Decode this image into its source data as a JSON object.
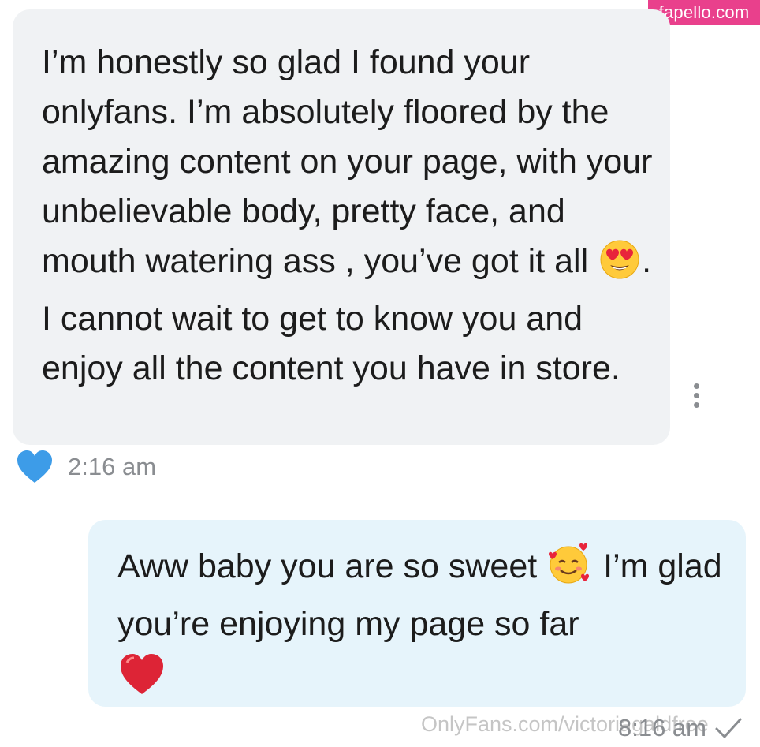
{
  "watermarks": {
    "top": "fapello.com",
    "bottom": "OnlyFans.com/victoriagaldfree"
  },
  "messages": [
    {
      "direction": "incoming",
      "text_part1": "I’m honestly so glad I found your onlyfans. I’m absolutely floored by the amazing content on your page, with your unbelievable body, pretty face, and mouth watering ass , you’ve got it all",
      "emoji1": "heart-eyes-emoji",
      "text_part2": ". I cannot wait to get to know you and enjoy all the content you have in store.",
      "time": "2:16 am",
      "liked": true
    },
    {
      "direction": "outgoing",
      "text_part1": "Aww baby you are so sweet",
      "emoji1": "smiling-face-with-hearts-emoji",
      "text_part2": "I’m glad you’re enjoying my page so far",
      "emoji2": "red-heart-emoji",
      "time": "8:16 am",
      "read": true
    }
  ],
  "colors": {
    "incoming_bubble": "#f0f2f4",
    "outgoing_bubble": "#e6f4fb",
    "like_heart": "#3d9ce8",
    "meta_text": "#8a8d91",
    "watermark_bg": "#e9408c"
  }
}
